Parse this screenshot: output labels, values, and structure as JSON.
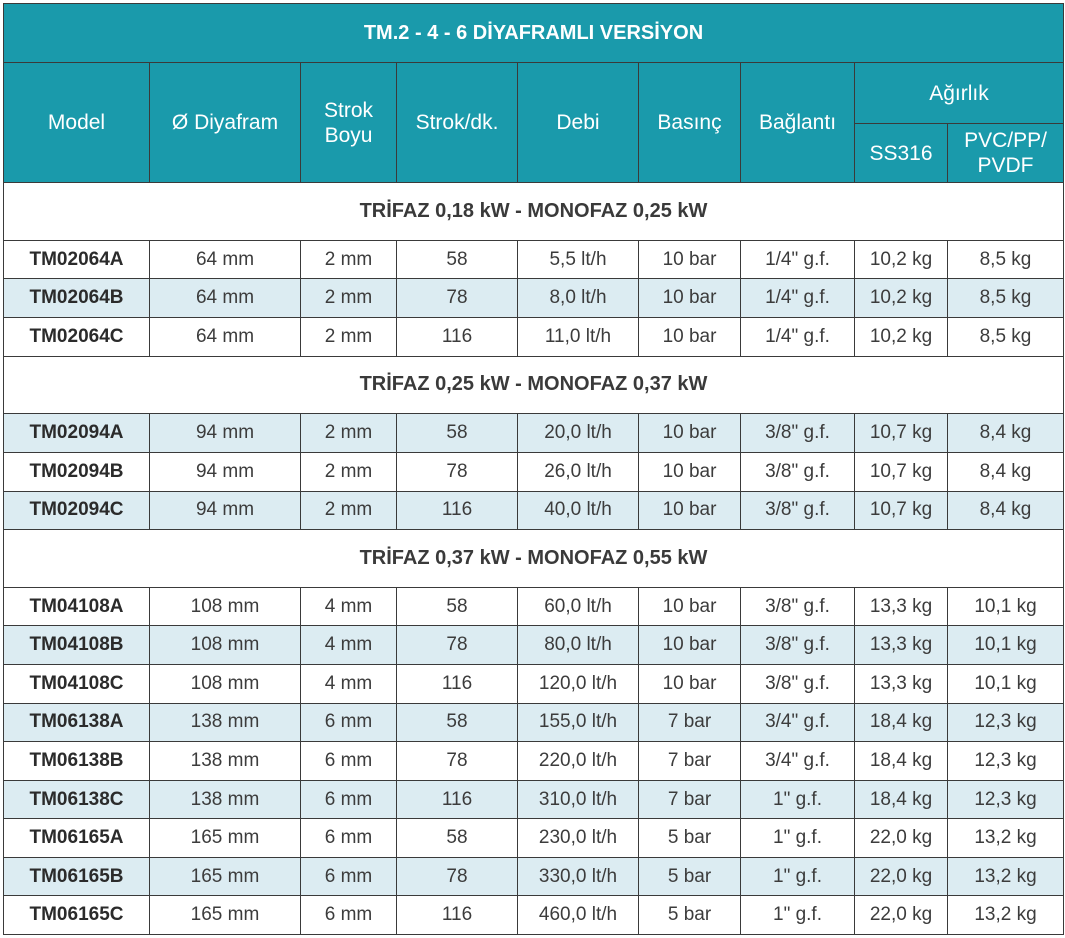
{
  "title": "TM.2 - 4 - 6 DİYAFRAMLI VERSİYON",
  "headers": {
    "model": "Model",
    "diyafram": "Ø Diyafram",
    "strok_boyu_1": "Strok",
    "strok_boyu_2": "Boyu",
    "strok_dk": "Strok/dk.",
    "debi": "Debi",
    "basinc": "Basınç",
    "baglanti": "Bağlantı",
    "agirlik": "Ağırlık",
    "ss316": "SS316",
    "pvc_1": "PVC/PP/",
    "pvc_2": "PVDF"
  },
  "sections": [
    {
      "title": "TRİFAZ 0,18 kW - MONOFAZ 0,25 kW",
      "rows": [
        {
          "model": "TM02064A",
          "diyafram": "64 mm",
          "strok": "2 mm",
          "strok_dk": "58",
          "debi": "5,5 lt/h",
          "basinc": "10 bar",
          "baglanti": "1/4\" g.f.",
          "ss316": "10,2 kg",
          "pvc": "8,5 kg"
        },
        {
          "model": "TM02064B",
          "diyafram": "64 mm",
          "strok": "2 mm",
          "strok_dk": "78",
          "debi": "8,0 lt/h",
          "basinc": "10 bar",
          "baglanti": "1/4\" g.f.",
          "ss316": "10,2 kg",
          "pvc": "8,5 kg"
        },
        {
          "model": "TM02064C",
          "diyafram": "64 mm",
          "strok": "2 mm",
          "strok_dk": "116",
          "debi": "11,0 lt/h",
          "basinc": "10 bar",
          "baglanti": "1/4\" g.f.",
          "ss316": "10,2 kg",
          "pvc": "8,5 kg"
        }
      ]
    },
    {
      "title": "TRİFAZ 0,25 kW - MONOFAZ 0,37 kW",
      "rows": [
        {
          "model": "TM02094A",
          "diyafram": "94 mm",
          "strok": "2 mm",
          "strok_dk": "58",
          "debi": "20,0 lt/h",
          "basinc": "10 bar",
          "baglanti": "3/8\" g.f.",
          "ss316": "10,7 kg",
          "pvc": "8,4 kg"
        },
        {
          "model": "TM02094B",
          "diyafram": "94 mm",
          "strok": "2 mm",
          "strok_dk": "78",
          "debi": "26,0 lt/h",
          "basinc": "10 bar",
          "baglanti": "3/8\" g.f.",
          "ss316": "10,7 kg",
          "pvc": "8,4 kg"
        },
        {
          "model": "TM02094C",
          "diyafram": "94 mm",
          "strok": "2 mm",
          "strok_dk": "116",
          "debi": "40,0 lt/h",
          "basinc": "10 bar",
          "baglanti": "3/8\" g.f.",
          "ss316": "10,7 kg",
          "pvc": "8,4 kg"
        }
      ]
    },
    {
      "title": "TRİFAZ 0,37 kW - MONOFAZ 0,55 kW",
      "rows": [
        {
          "model": "TM04108A",
          "diyafram": "108 mm",
          "strok": "4 mm",
          "strok_dk": "58",
          "debi": "60,0 lt/h",
          "basinc": "10 bar",
          "baglanti": "3/8\" g.f.",
          "ss316": "13,3 kg",
          "pvc": "10,1 kg"
        },
        {
          "model": "TM04108B",
          "diyafram": "108 mm",
          "strok": "4 mm",
          "strok_dk": "78",
          "debi": "80,0 lt/h",
          "basinc": "10 bar",
          "baglanti": "3/8\" g.f.",
          "ss316": "13,3 kg",
          "pvc": "10,1 kg"
        },
        {
          "model": "TM04108C",
          "diyafram": "108 mm",
          "strok": "4 mm",
          "strok_dk": "116",
          "debi": "120,0 lt/h",
          "basinc": "10 bar",
          "baglanti": "3/8\" g.f.",
          "ss316": "13,3 kg",
          "pvc": "10,1 kg"
        },
        {
          "model": "TM06138A",
          "diyafram": "138 mm",
          "strok": "6 mm",
          "strok_dk": "58",
          "debi": "155,0 lt/h",
          "basinc": "7 bar",
          "baglanti": "3/4\" g.f.",
          "ss316": "18,4 kg",
          "pvc": "12,3 kg"
        },
        {
          "model": "TM06138B",
          "diyafram": "138 mm",
          "strok": "6 mm",
          "strok_dk": "78",
          "debi": "220,0 lt/h",
          "basinc": "7 bar",
          "baglanti": "3/4\" g.f.",
          "ss316": "18,4 kg",
          "pvc": "12,3 kg"
        },
        {
          "model": "TM06138C",
          "diyafram": "138 mm",
          "strok": "6 mm",
          "strok_dk": "116",
          "debi": "310,0 lt/h",
          "basinc": "7 bar",
          "baglanti": "1\" g.f.",
          "ss316": "18,4 kg",
          "pvc": "12,3 kg"
        },
        {
          "model": "TM06165A",
          "diyafram": "165 mm",
          "strok": "6 mm",
          "strok_dk": "58",
          "debi": "230,0 lt/h",
          "basinc": "5 bar",
          "baglanti": "1\" g.f.",
          "ss316": "22,0 kg",
          "pvc": "13,2 kg"
        },
        {
          "model": "TM06165B",
          "diyafram": "165 mm",
          "strok": "6 mm",
          "strok_dk": "78",
          "debi": "330,0 lt/h",
          "basinc": "5 bar",
          "baglanti": "1\" g.f.",
          "ss316": "22,0 kg",
          "pvc": "13,2 kg"
        },
        {
          "model": "TM06165C",
          "diyafram": "165 mm",
          "strok": "6 mm",
          "strok_dk": "116",
          "debi": "460,0 lt/h",
          "basinc": "5 bar",
          "baglanti": "1\" g.f.",
          "ss316": "22,0 kg",
          "pvc": "13,2 kg"
        }
      ]
    }
  ]
}
